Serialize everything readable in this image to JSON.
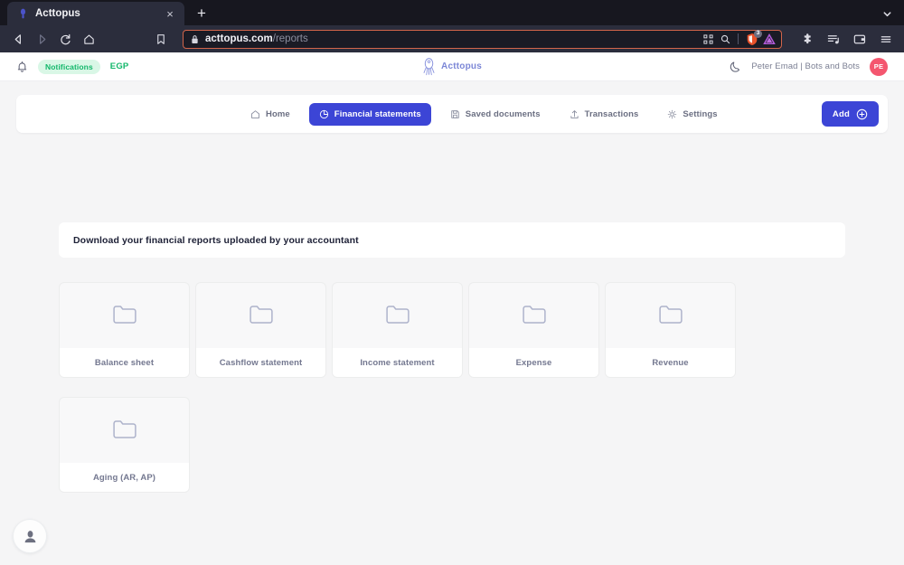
{
  "browser": {
    "tab": {
      "title": "Acttopus",
      "favicon": "acttopus-favicon",
      "close_label": "×"
    },
    "new_tab_label": "+",
    "tabstrip_chevron": "chevron-down-icon",
    "omnibox": {
      "domain": "acttopus.com",
      "path": "/reports",
      "lock_icon": "lock-icon",
      "qr_icon": "qr-code-icon",
      "search_icon": "search-icon",
      "shield_icon": "brave-shield-icon",
      "shield_count": "3",
      "extension_icon": "triangle-extension-icon",
      "focus_ring_color": "#d2654a"
    },
    "nav": {
      "back": "back-arrow-icon",
      "forward": "forward-arrow-icon",
      "reload": "reload-icon",
      "home": "home-icon",
      "bookmark": "bookmark-icon"
    },
    "toolbar_right": [
      "extensions-puzzle-icon",
      "playlist-icon",
      "wallet-icon",
      "hamburger-menu-icon"
    ]
  },
  "app_header": {
    "bell_icon": "bell-icon",
    "notifications_label": "Notifications",
    "currency": "EGP",
    "brand": {
      "name": "Acttopus",
      "logo_icon": "acttopus-logo-icon",
      "color": "#7b86d6"
    },
    "theme_toggle_icon": "moon-icon",
    "user": {
      "name": "Peter Emad | Bots and Bots",
      "initials": "PE",
      "avatar_color": "#f4566f"
    }
  },
  "nav_tabs": {
    "items": [
      {
        "label": "Home",
        "icon": "home-icon",
        "active": false
      },
      {
        "label": "Financial statements",
        "icon": "pie-chart-icon",
        "active": true
      },
      {
        "label": "Saved documents",
        "icon": "save-disk-icon",
        "active": false
      },
      {
        "label": "Transactions",
        "icon": "upload-icon",
        "active": false
      },
      {
        "label": "Settings",
        "icon": "gear-icon",
        "active": false
      }
    ],
    "add_button": {
      "label": "Add",
      "icon": "plus-circle-icon",
      "color": "#3c45d6"
    }
  },
  "main": {
    "heading": "Download your financial reports uploaded by your accountant",
    "report_cards": [
      {
        "label": "Balance sheet",
        "icon": "folder-icon"
      },
      {
        "label": "Cashflow statement",
        "icon": "folder-icon"
      },
      {
        "label": "Income statement",
        "icon": "folder-icon"
      },
      {
        "label": "Expense",
        "icon": "folder-icon"
      },
      {
        "label": "Revenue",
        "icon": "folder-icon"
      },
      {
        "label": "Aging (AR, AP)",
        "icon": "folder-icon"
      }
    ]
  },
  "fab": {
    "icon": "user-avatar-icon"
  }
}
